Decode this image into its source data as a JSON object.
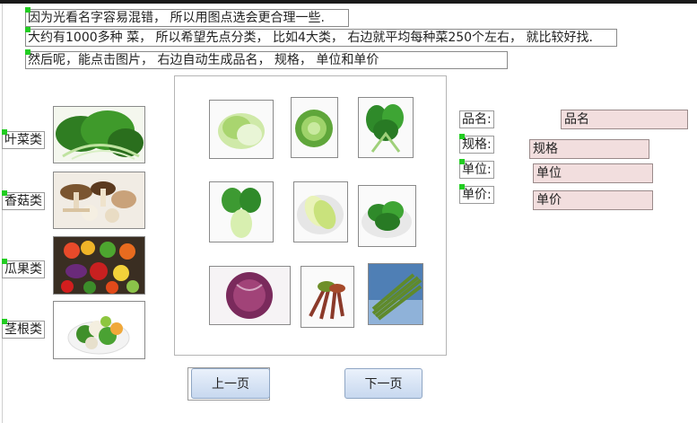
{
  "notes": [
    "因为光看名字容易混错， 所以用图点选会更合理一些.",
    "大约有1000多种 菜， 所以希望先点分类， 比如4大类， 右边就平均每种菜250个左右， 就比较好找.",
    "然后呢，能点击图片， 右边自动生成品名， 规格， 单位和单价"
  ],
  "categories": [
    {
      "label": "叶菜类",
      "icon": "leafy-greens-photo"
    },
    {
      "label": "香菇类",
      "icon": "mushrooms-photo"
    },
    {
      "label": "瓜果类",
      "icon": "fruits-vegetables-photo"
    },
    {
      "label": "茎根类",
      "icon": "root-vegetables-photo"
    }
  ],
  "gallery": {
    "items": [
      {
        "icon": "napa-cabbage-photo"
      },
      {
        "icon": "green-cabbage-photo"
      },
      {
        "icon": "leafy-greens-bunch-photo"
      },
      {
        "icon": "bok-choy-photo"
      },
      {
        "icon": "chinese-cabbage-plate-photo"
      },
      {
        "icon": "spinach-photo"
      },
      {
        "icon": "red-cabbage-photo"
      },
      {
        "icon": "toon-sprouts-photo"
      },
      {
        "icon": "asparagus-photo"
      }
    ]
  },
  "detail": {
    "name_label": "品名:",
    "name_value": "品名",
    "spec_label": "规格:",
    "spec_value": "规格",
    "unit_label": "单位:",
    "unit_value": "单位",
    "price_label": "单价:",
    "price_value": "单价"
  },
  "pager": {
    "prev_label": "上一页",
    "next_label": "下一页"
  },
  "colors": {
    "marker": "#22cc22",
    "field_bg": "#f2dede",
    "button_top": "#eaf1fb",
    "button_bottom": "#c7d8ef"
  }
}
